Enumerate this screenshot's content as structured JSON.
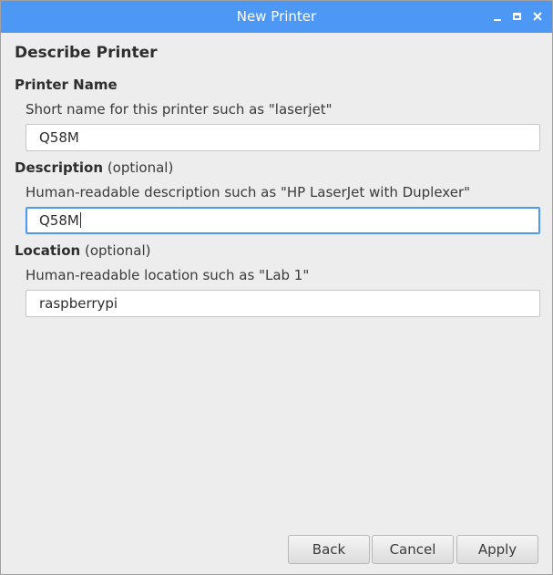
{
  "window": {
    "title": "New Printer"
  },
  "page": {
    "heading": "Describe Printer"
  },
  "printer_name": {
    "label": "Printer Name",
    "hint": "Short name for this printer such as \"laserjet\"",
    "value": "Q58M"
  },
  "description": {
    "label": "Description",
    "optional": "(optional)",
    "hint": "Human-readable description such as \"HP LaserJet with Duplexer\"",
    "value": "Q58M"
  },
  "location": {
    "label": "Location",
    "optional": "(optional)",
    "hint": "Human-readable location such as \"Lab 1\"",
    "value": "raspberrypi"
  },
  "buttons": {
    "back": "Back",
    "cancel": "Cancel",
    "apply": "Apply"
  },
  "colors": {
    "titlebar": "#4d98f5",
    "background": "#ededed",
    "focus": "#4d98f5"
  },
  "icons": {
    "minimize": "minimize-icon",
    "maximize": "maximize-icon",
    "close": "close-icon"
  }
}
